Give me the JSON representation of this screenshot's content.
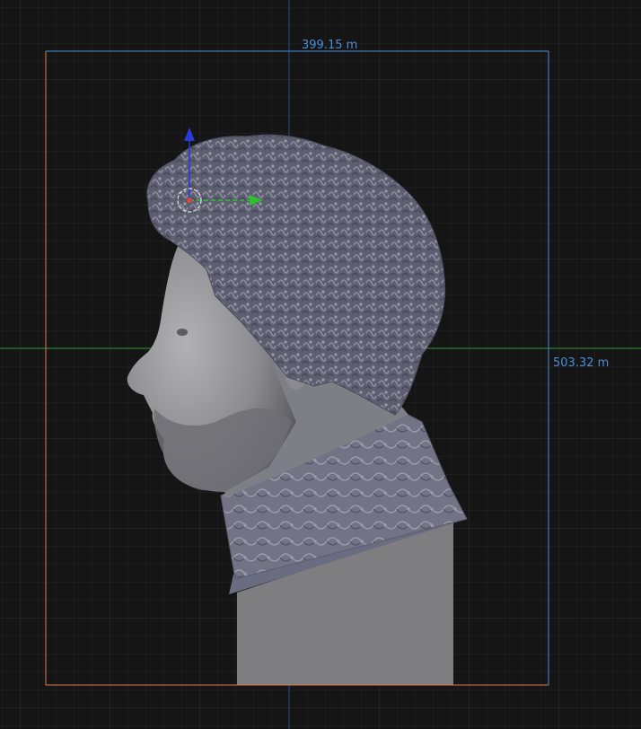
{
  "viewport": {
    "dimension_width": "399.15 m",
    "dimension_height": "503.32 m",
    "colors": {
      "background": "#151515",
      "grid_minor": "#242424",
      "grid_major": "#2c2c2c",
      "axis_x": "#2f7d2f",
      "axis_z": "#2c3f7a",
      "bounds_left_bottom": "#e07a50",
      "bounds_top_right": "#4c8fd6",
      "model": "#7c7e90",
      "pedestal": "#7d7d7f"
    },
    "gizmo_icons": [
      "origin-point-icon",
      "z-arrow-icon",
      "y-arrow-icon"
    ]
  }
}
